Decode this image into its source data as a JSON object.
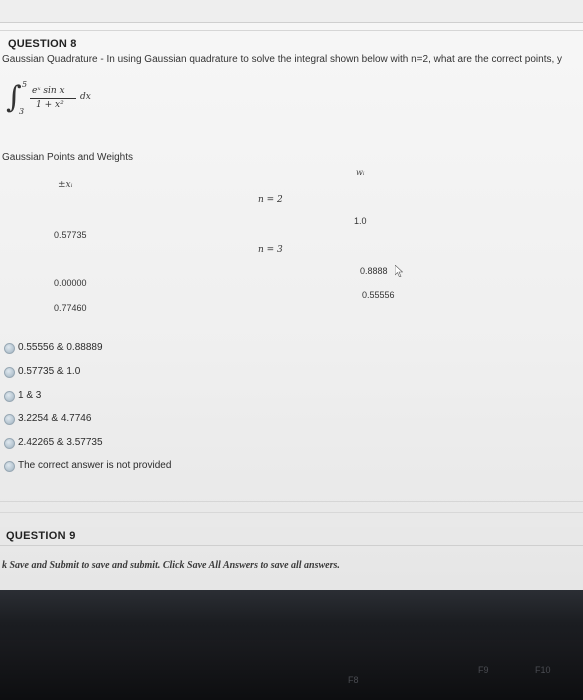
{
  "question8": {
    "title": "QUESTION 8",
    "prompt": "Gaussian Quadrature - In using Gaussian quadrature to solve the integral shown below with n=2, what are the correct points, y",
    "integral": {
      "upper_limit": "5",
      "lower_limit": "3",
      "numerator": "eˣ sin x",
      "denominator": "1 + x²",
      "differential": "dx"
    },
    "table_label": "Gaussian Points and Weights",
    "col_x_header": "±xᵢ",
    "col_w_header": "wᵢ",
    "rows": {
      "n2_label": "n = 2",
      "n2_x": "0.57735",
      "n2_w": "1.0",
      "n3_label": "n = 3",
      "n3_x1": "0.00000",
      "n3_w1": "0.8888",
      "n3_x2": "0.77460",
      "n3_w2": "0.55556"
    },
    "options": [
      "0.55556 & 0.88889",
      "0.57735 & 1.0",
      "1 & 3",
      "3.2254 & 4.7746",
      "2.42265 & 3.57735",
      "The correct answer is not provided"
    ]
  },
  "question9": {
    "title": "QUESTION 9"
  },
  "footer": {
    "save_hint": "k Save and Submit to save and submit. Click Save All Answers to save all answers."
  },
  "keyboard": {
    "keys": [
      "F8",
      "F9",
      "F10"
    ]
  }
}
